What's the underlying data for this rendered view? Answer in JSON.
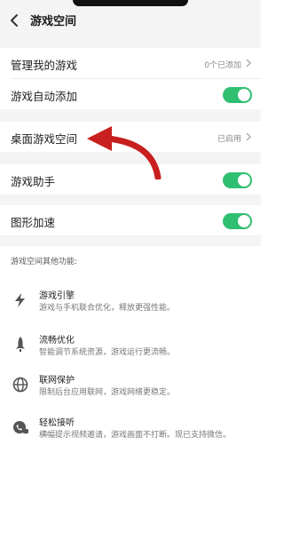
{
  "header": {
    "title": "游戏空间"
  },
  "settings": {
    "manage_label": "管理我的游戏",
    "manage_value": "0个已添加",
    "auto_add_label": "游戏自动添加",
    "desktop_label": "桌面游戏空间",
    "desktop_value": "已启用",
    "assistant_label": "游戏助手",
    "graphics_label": "图形加速"
  },
  "toggles": {
    "auto_add": true,
    "assistant": true,
    "graphics": true
  },
  "features_title": "游戏空间其他功能:",
  "features": [
    {
      "name": "游戏引擎",
      "desc": "游戏与手机联合优化，释放更强性能。",
      "icon": "lightning-icon"
    },
    {
      "name": "流畅优化",
      "desc": "智能调节系统资源，游戏运行更流畅。",
      "icon": "rocket-icon"
    },
    {
      "name": "联网保护",
      "desc": "限制后台应用联网，游戏网络更稳定。",
      "icon": "globe-icon"
    },
    {
      "name": "轻松接听",
      "desc": "横幅提示视频邀请，游戏画面不打断。现已支持微信。",
      "icon": "phone-chat-icon"
    }
  ],
  "colors": {
    "accent_green": "#2fbf71",
    "arrow_red": "#c8201e",
    "header_bg": "#f4f4f4"
  }
}
